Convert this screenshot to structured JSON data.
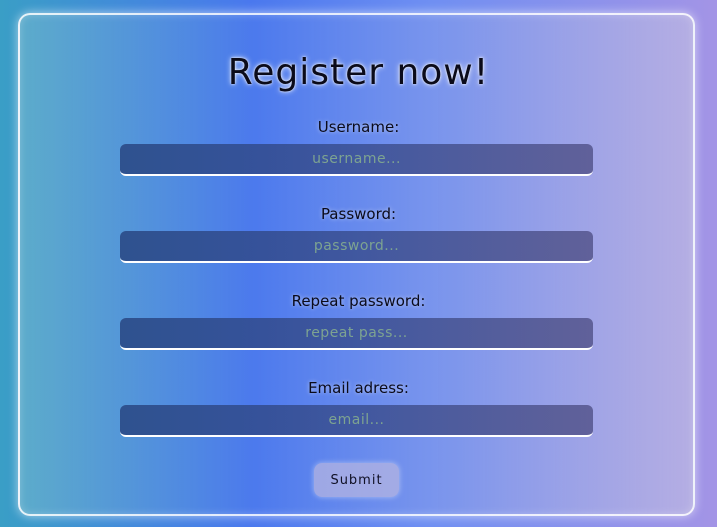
{
  "form": {
    "title": "Register now!",
    "fields": [
      {
        "label": "Username:",
        "placeholder": "username..."
      },
      {
        "label": "Password:",
        "placeholder": "password..."
      },
      {
        "label": "Repeat password:",
        "placeholder": "repeat pass..."
      },
      {
        "label": "Email adress:",
        "placeholder": "email..."
      }
    ],
    "submit_label": "Submit"
  },
  "colors": {
    "field_bottom_border": "#ffffff",
    "placeholder_text": "#7da391",
    "title_text": "#0b0b1a"
  }
}
